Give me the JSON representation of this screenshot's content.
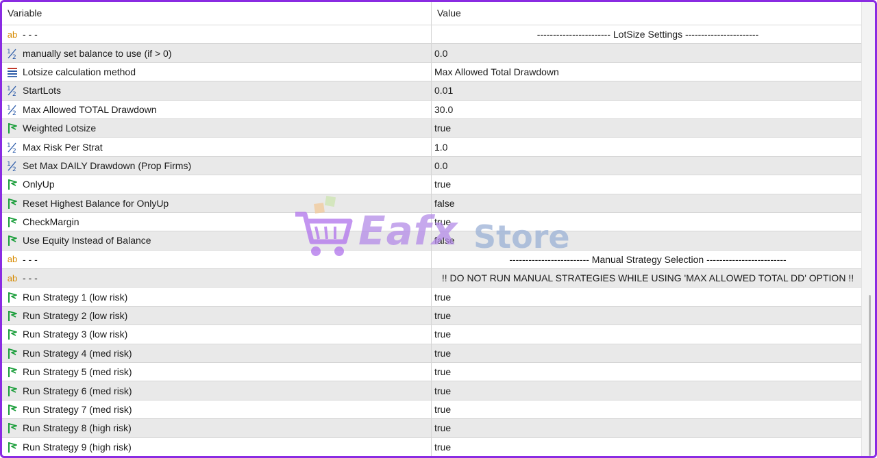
{
  "header": {
    "variable": "Variable",
    "value": "Value"
  },
  "rows": [
    {
      "icon": "ab-icon",
      "name": "- - -",
      "value": "----------------------- LotSize Settings -----------------------",
      "style": "centered"
    },
    {
      "icon": "half-icon",
      "name": "manually set balance to use (if > 0)",
      "value": "0.0"
    },
    {
      "icon": "list-icon",
      "name": "Lotsize calculation method",
      "value": "Max Allowed Total Drawdown"
    },
    {
      "icon": "half-icon",
      "name": "StartLots",
      "value": "0.01"
    },
    {
      "icon": "half-icon",
      "name": "Max Allowed TOTAL Drawdown",
      "value": "30.0"
    },
    {
      "icon": "flag-icon",
      "name": "Weighted Lotsize",
      "value": "true"
    },
    {
      "icon": "half-icon",
      "name": "Max Risk Per Strat",
      "value": "1.0"
    },
    {
      "icon": "half-icon",
      "name": "Set Max DAILY Drawdown (Prop Firms)",
      "value": "0.0"
    },
    {
      "icon": "flag-icon",
      "name": "OnlyUp",
      "value": "true"
    },
    {
      "icon": "flag-icon",
      "name": "Reset Highest Balance for OnlyUp",
      "value": "false"
    },
    {
      "icon": "flag-icon",
      "name": "CheckMargin",
      "value": "true"
    },
    {
      "icon": "flag-icon",
      "name": "Use Equity Instead of Balance",
      "value": "false"
    },
    {
      "icon": "ab-icon",
      "name": "- - -",
      "value": "------------------------- Manual Strategy Selection -------------------------",
      "style": "centered"
    },
    {
      "icon": "ab-icon",
      "name": "- - -",
      "value": "!! DO NOT RUN MANUAL STRATEGIES WHILE USING 'MAX ALLOWED TOTAL DD' OPTION !!",
      "style": "centered"
    },
    {
      "icon": "flag-icon",
      "name": "Run Strategy 1 (low risk)",
      "value": "true"
    },
    {
      "icon": "flag-icon",
      "name": "Run Strategy 2 (low risk)",
      "value": "true"
    },
    {
      "icon": "flag-icon",
      "name": "Run Strategy 3 (low risk)",
      "value": "true"
    },
    {
      "icon": "flag-icon",
      "name": "Run Strategy 4 (med risk)",
      "value": "true"
    },
    {
      "icon": "flag-icon",
      "name": "Run Strategy 5 (med risk)",
      "value": "true"
    },
    {
      "icon": "flag-icon",
      "name": "Run Strategy 6 (med risk)",
      "value": "true"
    },
    {
      "icon": "flag-icon",
      "name": "Run Strategy 7 (med risk)",
      "value": "true"
    },
    {
      "icon": "flag-icon",
      "name": "Run Strategy 8 (high risk)",
      "value": "true"
    },
    {
      "icon": "flag-icon",
      "name": "Run Strategy 9 (high risk)",
      "value": "true"
    }
  ],
  "icons": {
    "ab_text": "ab",
    "half_text": "½"
  },
  "watermark": {
    "brand": "Eafx",
    "suffix": "Store"
  },
  "colors": {
    "border": "#8a2be2",
    "flag": "#1a9e3a",
    "ab": "#d68a00",
    "alt_row": "#e9e9e9"
  }
}
